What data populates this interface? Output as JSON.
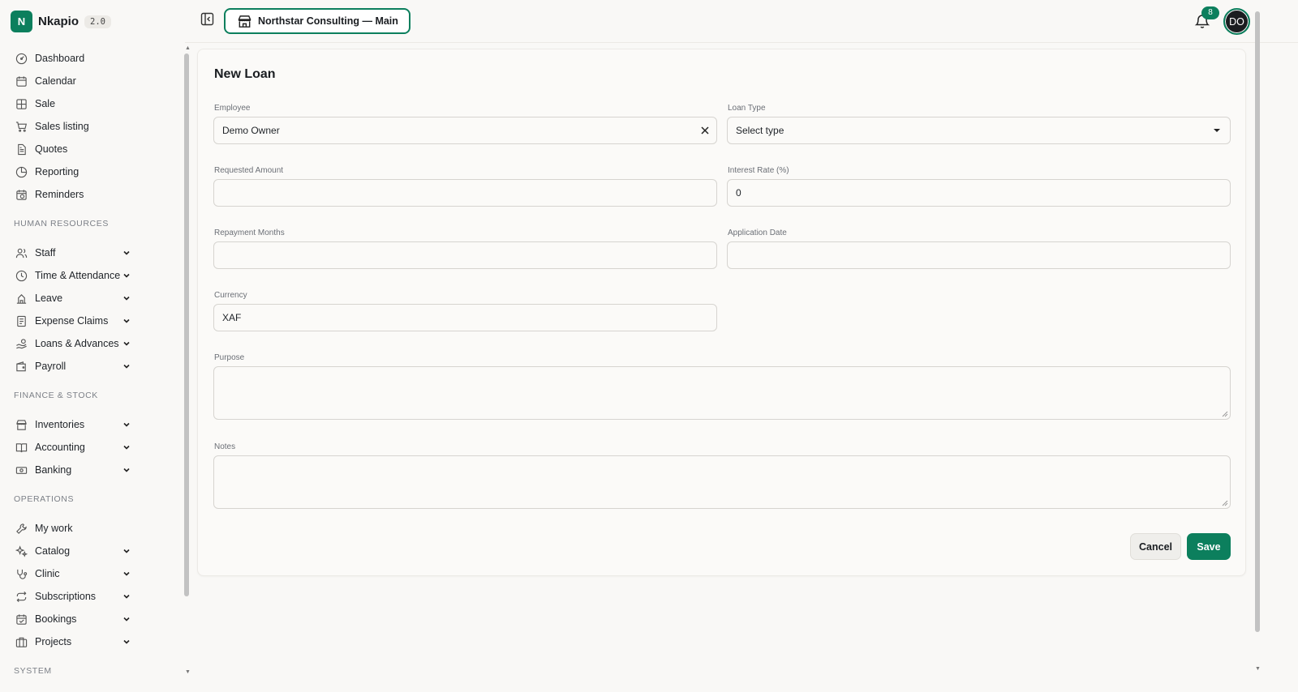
{
  "brand": {
    "logo_letter": "N",
    "name": "Nkapio",
    "version": "2.0"
  },
  "nav": {
    "top_items": [
      {
        "label": "Dashboard",
        "icon": "dashboard-gauge-icon"
      },
      {
        "label": "Calendar",
        "icon": "calendar-icon"
      },
      {
        "label": "Sale",
        "icon": "sale-grid-icon"
      },
      {
        "label": "Sales listing",
        "icon": "cart-icon"
      },
      {
        "label": "Quotes",
        "icon": "document-icon"
      },
      {
        "label": "Reporting",
        "icon": "pie-chart-icon"
      },
      {
        "label": "Reminders",
        "icon": "calendar-clock-icon"
      }
    ],
    "sections": [
      {
        "title": "HUMAN RESOURCES",
        "items": [
          {
            "label": "Staff",
            "icon": "users-icon"
          },
          {
            "label": "Time & Attendance",
            "icon": "clock-icon"
          },
          {
            "label": "Leave",
            "icon": "leave-icon"
          },
          {
            "label": "Expense Claims",
            "icon": "receipt-icon"
          },
          {
            "label": "Loans & Advances",
            "icon": "hand-coins-icon"
          },
          {
            "label": "Payroll",
            "icon": "wallet-icon"
          }
        ]
      },
      {
        "title": "FINANCE & STOCK",
        "items": [
          {
            "label": "Inventories",
            "icon": "store-icon"
          },
          {
            "label": "Accounting",
            "icon": "book-icon"
          },
          {
            "label": "Banking",
            "icon": "banknote-icon"
          }
        ]
      },
      {
        "title": "OPERATIONS",
        "items": [
          {
            "label": "My work",
            "icon": "wrench-icon"
          },
          {
            "label": "Catalog",
            "icon": "sparkles-icon"
          },
          {
            "label": "Clinic",
            "icon": "stethoscope-icon"
          },
          {
            "label": "Subscriptions",
            "icon": "repeat-icon"
          },
          {
            "label": "Bookings",
            "icon": "calendar-check-icon"
          },
          {
            "label": "Projects",
            "icon": "briefcase-icon"
          }
        ]
      },
      {
        "title": "SYSTEM",
        "items": []
      }
    ]
  },
  "topbar": {
    "org_name": "Northstar Consulting — Main",
    "notifications_count": "8",
    "avatar_initials": "DO"
  },
  "form": {
    "title": "New Loan",
    "employee": {
      "label": "Employee",
      "value": "Demo Owner"
    },
    "loan_type": {
      "label": "Loan Type",
      "value": "Select type"
    },
    "requested_amount": {
      "label": "Requested Amount",
      "value": ""
    },
    "interest_rate": {
      "label": "Interest Rate (%)",
      "value": "0"
    },
    "repayment_months": {
      "label": "Repayment Months",
      "value": ""
    },
    "application_date": {
      "label": "Application Date",
      "value": ""
    },
    "currency": {
      "label": "Currency",
      "value": "XAF"
    },
    "purpose": {
      "label": "Purpose",
      "value": ""
    },
    "notes": {
      "label": "Notes",
      "value": ""
    },
    "cancel_label": "Cancel",
    "save_label": "Save"
  },
  "colors": {
    "accent": "#0c7f5d",
    "background": "#f9f8f6",
    "avatar": "#1b1d20"
  }
}
